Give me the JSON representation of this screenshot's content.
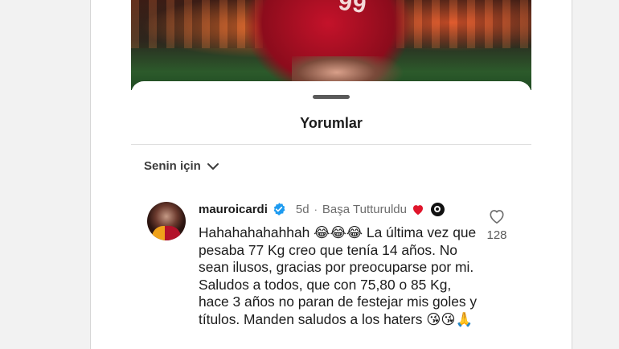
{
  "sheet": {
    "title": "Yorumlar",
    "filter_label": "Senin için"
  },
  "photo": {
    "jersey_number": "99"
  },
  "comment": {
    "username": "mauroicardi",
    "time": "5d",
    "separator": "·",
    "pinned_label": "Başa Tutturuldu",
    "text": "Hahahahahahhah 😂😂😂 La última vez que pesaba 77 Kg creo que tenía 14 años. No sean ilusos, gracias por preocuparse por mi. Saludos a todos, que con 75,80 o 85 Kg, hace 3 años no paran de festejar mis goles y títulos. Manden saludos a los haters 😘😘🙏",
    "like_count": "128"
  },
  "icons": {
    "verified": "verified-badge-icon",
    "creator_like": "heart-icon",
    "threads": "threads-icon",
    "like": "heart-outline-icon",
    "chevron": "chevron-down-icon"
  },
  "colors": {
    "verified_blue": "#1d9bf0",
    "heart_red": "#e0152b",
    "muted_text": "#6d6d6d"
  }
}
